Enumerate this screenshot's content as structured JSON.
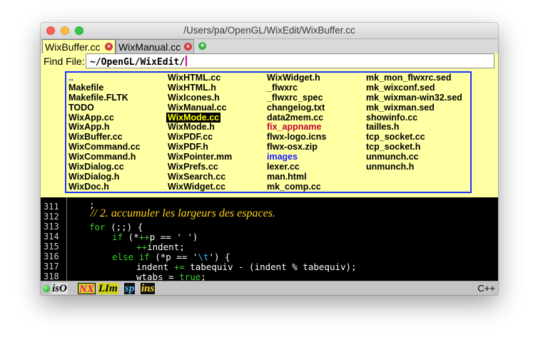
{
  "window": {
    "title": "/Users/pa/OpenGL/WixEdit/WixBuffer.cc"
  },
  "tabs": [
    {
      "label": "WixBuffer.cc",
      "active": true
    },
    {
      "label": "WixManual.cc",
      "active": false
    }
  ],
  "find": {
    "label": "Find File:",
    "value": "~/OpenGL/WixEdit/"
  },
  "file_list": {
    "columns": [
      [
        "..",
        "Makefile",
        "Makefile.FLTK",
        "TODO",
        "WixApp.cc",
        "WixApp.h",
        "WixBuffer.cc",
        "WixCommand.cc",
        "WixCommand.h",
        "WixDialog.cc",
        "WixDialog.h",
        "WixDoc.h"
      ],
      [
        "WixHTML.cc",
        "WixHTML.h",
        "WixIcones.h",
        "WixManual.cc",
        "WixMode.cc",
        "WixMode.h",
        "WixPDF.cc",
        "WixPDF.h",
        "WixPointer.mm",
        "WixPrefs.cc",
        "WixSearch.cc",
        "WixWidget.cc"
      ],
      [
        "WixWidget.h",
        "_flwxrc",
        "_flwxrc_spec",
        "changelog.txt",
        "data2mem.cc",
        "fix_appname",
        "flwx-logo.icns",
        "flwx-osx.zip",
        "images",
        "lexer.cc",
        "man.html",
        "mk_comp.cc"
      ],
      [
        "mk_mon_flwxrc.sed",
        "mk_wixconf.sed",
        "mk_wixman-win32.sed",
        "mk_wixman.sed",
        "showinfo.cc",
        "tailles.h",
        "tcp_socket.cc",
        "tcp_socket.h",
        "unmunch.cc",
        "unmunch.h"
      ]
    ],
    "selected": "WixMode.cc",
    "red_items": [
      "fix_appname"
    ],
    "blue_items": [
      "..",
      "images"
    ],
    "selected_colors": {
      "bg": "#000000",
      "fg": "#ffff00"
    }
  },
  "editor": {
    "line_numbers": [
      "311",
      "312",
      "313",
      "314",
      "315",
      "316",
      "317",
      "318"
    ],
    "line_311": ";",
    "comment_312": "// 2. accumuler les largeurs des espaces.",
    "l313": {
      "kw": "for",
      "rest": " (;;) {"
    },
    "l314": {
      "kw": "if",
      "rest1": " (*",
      "op": "++",
      "rest2": "p == ' ')"
    },
    "l315": {
      "op": "++",
      "rest": "indent;"
    },
    "l316": {
      "kw": "else if",
      "rest1": " (*p == '",
      "esc": "\\t",
      "rest2": "') {"
    },
    "l317": {
      "pre": "indent ",
      "op": "+=",
      "rest": " tabequiv - (indent % tabequiv);"
    },
    "l318": {
      "pre": "wtabs = ",
      "kw": "true",
      "rest": ";"
    },
    "colors": {
      "keyword": "#39d12c",
      "comment": "#ffd21a",
      "escape": "#2eb7e8",
      "text": "#ffffff"
    }
  },
  "statusbar": {
    "badges": [
      "isO",
      "NX",
      "LIm",
      "sp",
      "ins"
    ],
    "language": "C++"
  }
}
